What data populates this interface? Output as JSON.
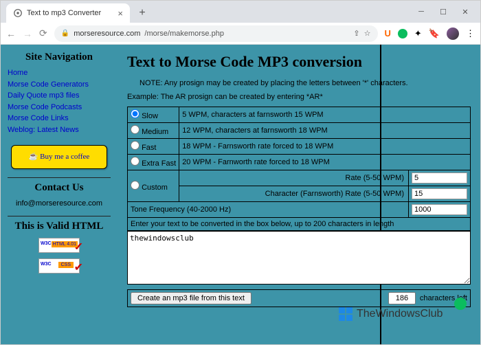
{
  "browser": {
    "tab_title": "Text to mp3 Converter",
    "url_domain": "morseresource.com",
    "url_path": "/morse/makemorse.php"
  },
  "sidebar": {
    "nav_heading": "Site Navigation",
    "links": [
      "Home",
      "Morse Code Generators",
      "Daily Quote mp3 files",
      "Morse Code Podcasts",
      "Morse Code Links",
      "Weblog: Latest News"
    ],
    "coffee": "Buy me a coffee",
    "contact_heading": "Contact Us",
    "email": "info@morseresource.com",
    "valid_heading": "This is Valid HTML"
  },
  "main": {
    "title": "Text to Morse Code MP3 conversion",
    "note1": "NOTE: Any prosign may be created by placing the letters between '*' characters.",
    "note2": "Example: The AR prosign can be created by entering *AR*",
    "speeds": [
      {
        "label": "Slow",
        "desc": "5 WPM, characters at farnsworth 15 WPM",
        "checked": true
      },
      {
        "label": "Medium",
        "desc": "12 WPM, characters at farnsworth 18 WPM",
        "checked": false
      },
      {
        "label": "Fast",
        "desc": "18 WPM - Farnsworth rate forced to 18 WPM",
        "checked": false
      },
      {
        "label": "Extra Fast",
        "desc": "20 WPM - Farnworth rate forced to 18 WPM",
        "checked": false
      }
    ],
    "custom_label": "Custom",
    "rate_label": "Rate (5-50 WPM)",
    "rate_value": "5",
    "char_rate_label": "Character (Farnsworth) Rate (5-50 WPM)",
    "char_rate_value": "15",
    "tone_label": "Tone Frequency (40-2000 Hz)",
    "tone_value": "1000",
    "textarea_prompt": "Enter your text to be converted in the box below, up to 200 characters in length",
    "textarea_value": "thewindowsclub",
    "submit_label": "Create an mp3 file from this text",
    "chars_left_value": "186",
    "chars_left_label": "characters left",
    "watermark": "TheWindowsClub"
  }
}
